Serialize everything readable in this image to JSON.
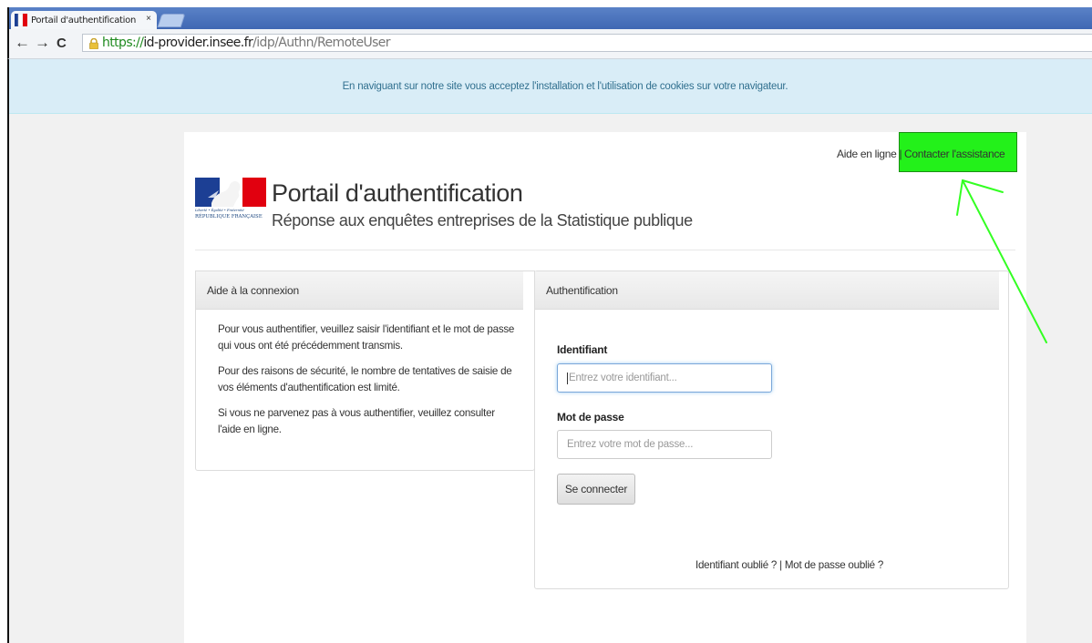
{
  "browser": {
    "tab_title": "Portail d'authentification",
    "tab_close": "×",
    "back_icon": "←",
    "forward_icon": "→",
    "reload_icon": "C",
    "url_scheme": "https://",
    "url_host": "id-provider.insee.fr",
    "url_path": "/idp/Authn/RemoteUser"
  },
  "cookie_banner": {
    "text": "En naviguant sur notre site vous acceptez l'installation et l'utilisation de cookies sur votre navigateur."
  },
  "header": {
    "help_link": "Aide en ligne",
    "separator": "|",
    "assistance_link": "Contacter l'assistance",
    "logo_motto": "Liberté • Égalité • Fraternité",
    "logo_name": "RÉPUBLIQUE FRANÇAISE",
    "title": "Portail d'authentification",
    "subtitle": "Réponse aux enquêtes entreprises de la Statistique publique"
  },
  "help_panel": {
    "heading": "Aide à la connexion",
    "paragraphs": [
      "Pour vous authentifier, veuillez saisir l'identifiant et le mot de passe qui vous ont été précédemment transmis.",
      "Pour des raisons de sécurité, le nombre de tentatives de saisie de vos éléments d'authentification est limité.",
      "Si vous ne parvenez pas à  vous authentifier, veuillez consulter l'aide en ligne."
    ]
  },
  "auth_panel": {
    "heading": "Authentification",
    "identifier_label": "Identifiant",
    "identifier_placeholder": "Entrez votre identifiant...",
    "password_label": "Mot de passe",
    "password_placeholder": "Entrez votre mot de passe...",
    "submit_label": "Se connecter",
    "forgot_identifier": "Identifiant oublié ?",
    "forgot_separator": "|",
    "forgot_password": "Mot de passe oublié ?"
  },
  "colors": {
    "highlight": "#23f11a",
    "annotation_arrow": "#33ff22",
    "banner_bg": "#d9edf7",
    "banner_text": "#31708f"
  }
}
